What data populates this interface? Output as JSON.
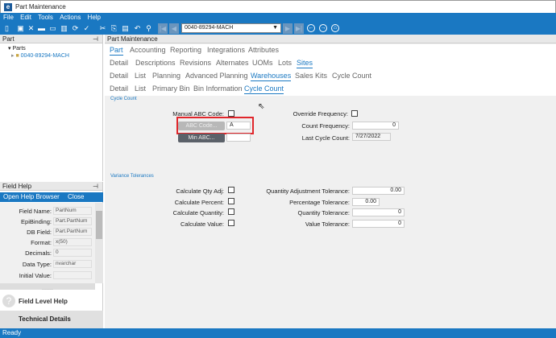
{
  "window": {
    "title": "Part Maintenance"
  },
  "menu": [
    "File",
    "Edit",
    "Tools",
    "Actions",
    "Help"
  ],
  "toolbar": {
    "part_combo": "0040-89294-MACH"
  },
  "left_panel": {
    "title": "Part",
    "tree_root": "Parts",
    "tree_child": "0040-89294-MACH"
  },
  "main": {
    "title": "Part Maintenance",
    "tabs1": [
      "Part",
      "Accounting",
      "Reporting",
      "Integrations",
      "Attributes"
    ],
    "tabs2": [
      "Detail",
      "Descriptions",
      "Revisions",
      "Alternates",
      "UOMs",
      "Lots",
      "Sites"
    ],
    "tabs3": [
      "Detail",
      "List",
      "Planning",
      "Advanced Planning",
      "Warehouses",
      "Sales Kits",
      "Cycle Count"
    ],
    "tabs4": [
      "Detail",
      "List",
      "Primary Bin",
      "Bin Information",
      "Cycle Count"
    ],
    "cycle_count": {
      "section": "Cycle Count",
      "manual_abc_label": "Manual ABC Code:",
      "abc_code_button": "ABC Code...",
      "abc_code_value": "A",
      "min_abc_button": "Min ABC...",
      "override_freq_label": "Override Frequency:",
      "count_freq_label": "Count Frequency:",
      "count_freq_value": "0",
      "last_cycle_label": "Last Cycle Count:",
      "last_cycle_value": "7/27/2022"
    },
    "variance": {
      "section": "Variance Tolerances",
      "calc_qty_adj": "Calculate Qty Adj:",
      "calc_percent": "Calculate Percent:",
      "calc_quantity": "Calculate Quantity:",
      "calc_value": "Calculate Value:",
      "qty_adj_tol_label": "Quantity Adjustment Tolerance:",
      "qty_adj_tol_value": "0.00",
      "pct_tol_label": "Percentage Tolerance:",
      "pct_tol_value": "0.00",
      "qty_tol_label": "Quantity Tolerance:",
      "qty_tol_value": "0",
      "value_tol_label": "Value Tolerance:",
      "value_tol_value": "0"
    }
  },
  "field_help": {
    "title": "Field Help",
    "open_browser": "Open Help Browser",
    "close": "Close",
    "rows": [
      {
        "label": "Field Name:",
        "value": "PartNum"
      },
      {
        "label": "EpiBinding:",
        "value": "Part.PartNum"
      },
      {
        "label": "DB Field:",
        "value": "Part.PartNum"
      },
      {
        "label": "Format:",
        "value": "x(50)"
      },
      {
        "label": "Decimals:",
        "value": "0"
      },
      {
        "label": "Data Type:",
        "value": "nvarchar"
      },
      {
        "label": "Initial Value:",
        "value": ""
      }
    ],
    "field_level_help": "Field Level Help",
    "technical_details": "Technical Details"
  },
  "status": "Ready",
  "colors": {
    "accent": "#1a78c2",
    "highlight": "#e0262b"
  }
}
